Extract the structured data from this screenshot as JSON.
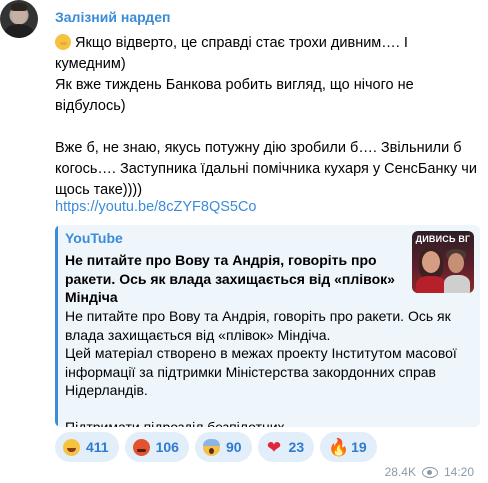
{
  "author": "Залізний нардеп",
  "message": {
    "line1": "Якщо відверто, це справді стає трохи дивним…. І кумедним)",
    "line2": "Як вже тиждень Банкова робить вигляд, що нічого не",
    "line3": "відбулось)",
    "line4": "Вже б, не знаю, якусь потужну дію зробили б…. Звільнили б",
    "line5": "когось…. Заступника їдальні помічника кухаря у СенсБанку чи",
    "line6": "щось таке))))"
  },
  "link": "https://youtu.be/8cZYF8QS5Co",
  "preview": {
    "site": "YouTube",
    "title": "Не питайте про Вову та Андрія, говоріть про ракети. Ось як влада захищається від «плівок» Міндіча",
    "desc1": "Не питайте про Вову та Андрія, говоріть про ракети. Ось як влада захищається від «плівок» Міндіча.",
    "desc2": "Цей матеріал створено в межах проекту Інститутом масової інформації за підтримки Міністерства закордонних справ Нідерландів.",
    "desc3": "Підтримати підрозділ безпілотних…",
    "thumb_text": "ДИВИСЬ ВГ"
  },
  "reactions": [
    {
      "icon": "rofl-emoji",
      "count": "411"
    },
    {
      "icon": "angry-emoji",
      "count": "106"
    },
    {
      "icon": "scream-emoji",
      "count": "90"
    },
    {
      "icon": "heart-emoji",
      "count": "23"
    },
    {
      "icon": "fire-emoji",
      "count": "19"
    }
  ],
  "views": "28.4K",
  "time": "14:20",
  "colors": {
    "accent": "#3a8bd8",
    "preview_bg": "#eef5fb",
    "reaction_bg": "#e2eef9",
    "meta": "#8b9aa7"
  }
}
